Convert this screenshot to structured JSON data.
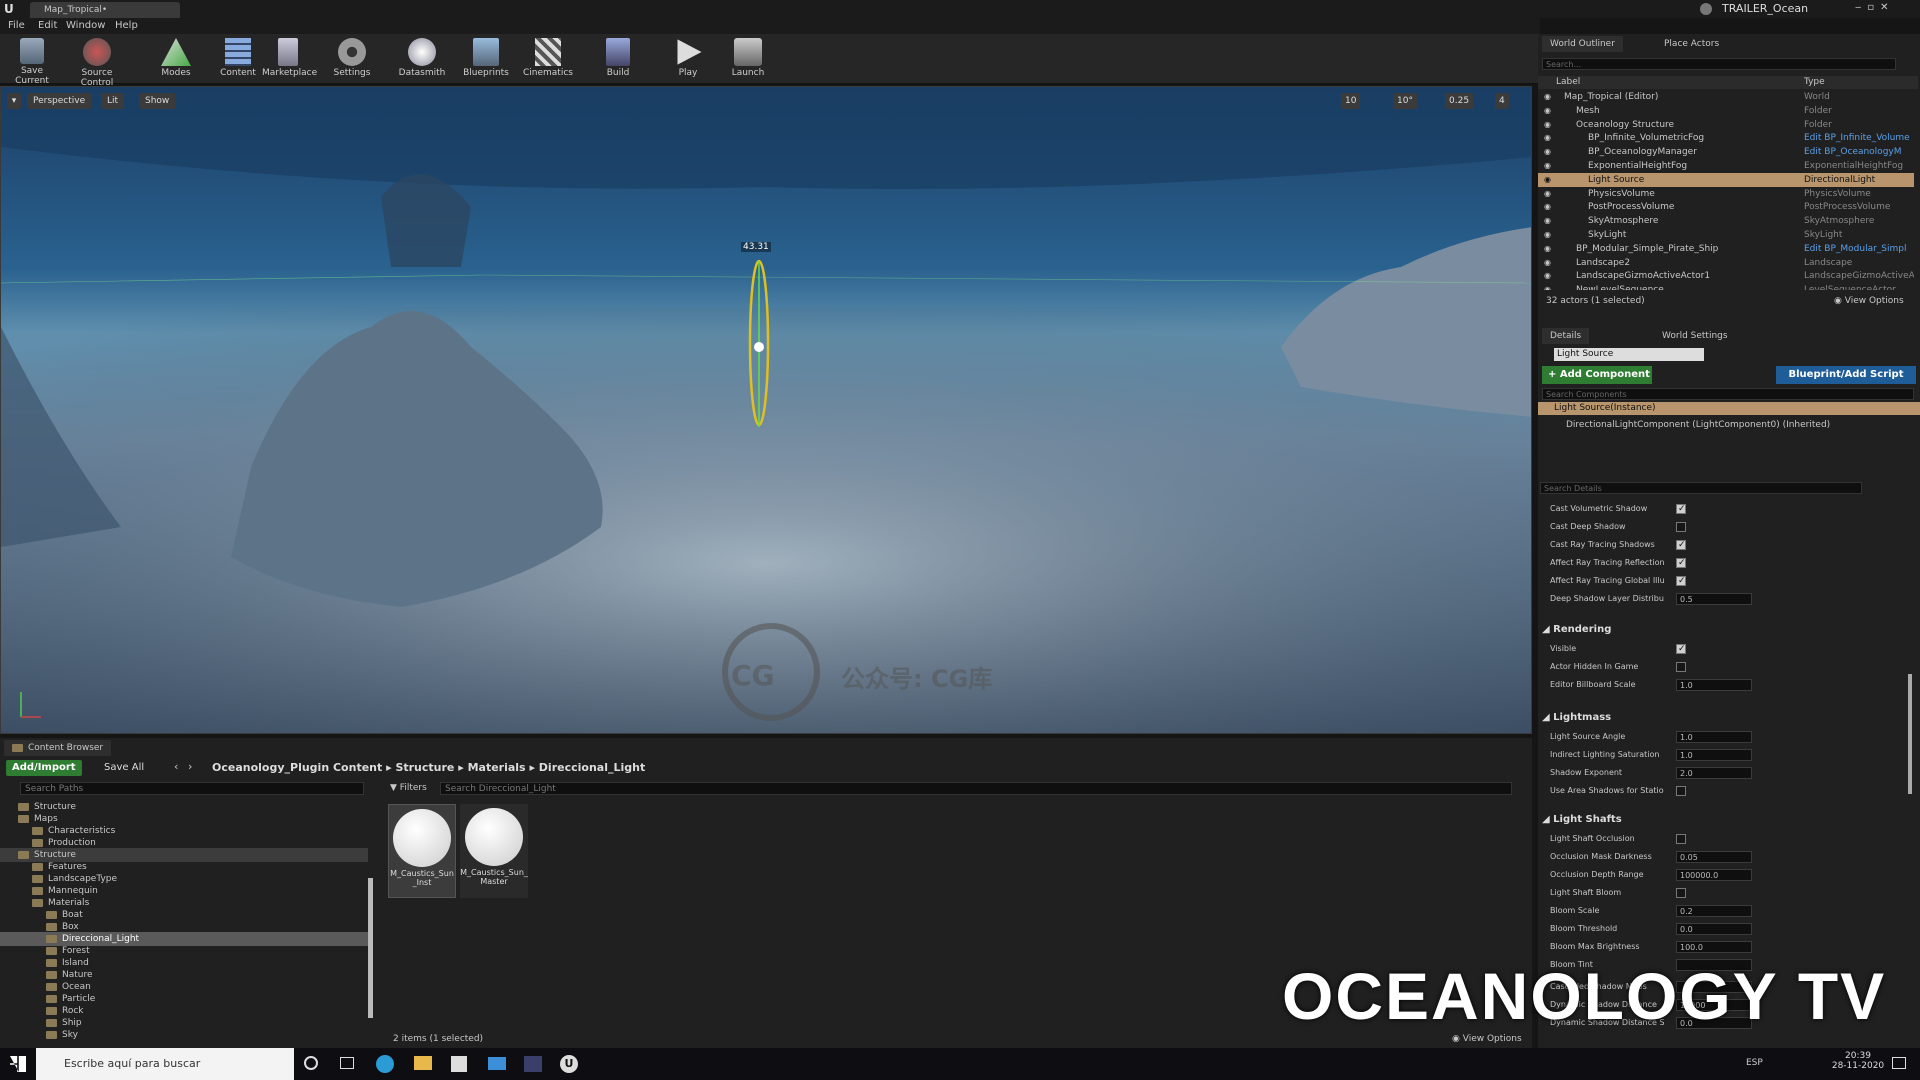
{
  "window": {
    "tab": "Map_Tropical•",
    "project": "TRAILER_Ocean"
  },
  "menu": [
    "File",
    "Edit",
    "Window",
    "Help"
  ],
  "toolbar": [
    "Save Current",
    "Source Control",
    "Modes",
    "Content",
    "Marketplace",
    "Settings",
    "Datasmith",
    "Blueprints",
    "Cinematics",
    "Build",
    "Play",
    "Launch"
  ],
  "viewport": {
    "perspective": "Perspective",
    "lit": "Lit",
    "show": "Show",
    "grid_snap": "10",
    "rot_snap": "10°",
    "scale_snap": "0.25",
    "cam_speed": "4",
    "gizmo_value": "43.31",
    "watermark_text": "公众号: CG库",
    "watermark_logo": "CG"
  },
  "content_browser": {
    "tab": "Content Browser",
    "add_import": "Add/Import",
    "save_all": "Save All",
    "path": [
      "Oceanology_Plugin Content",
      "Structure",
      "Materials",
      "Direccional_Light"
    ],
    "search_paths": "Search Paths",
    "filters": "Filters",
    "search_assets": "Search Direccional_Light",
    "tree": [
      "Structure",
      "Maps",
      "Characteristics",
      "Production",
      "Structure",
      "Features",
      "LandscapeType",
      "Mannequin",
      "Materials",
      "Boat",
      "Box",
      "Direccional_Light",
      "Forest",
      "Island",
      "Nature",
      "Ocean",
      "Particle",
      "Rock",
      "Ship",
      "Sky"
    ],
    "assets": [
      {
        "name": "M_Caustics_Sun_Inst"
      },
      {
        "name": "M_Caustics_Sun_Master"
      }
    ],
    "status": "2 items (1 selected)",
    "view_options": "View Options"
  },
  "outliner": {
    "tabs": [
      "World Outliner",
      "Place Actors"
    ],
    "search": "Search...",
    "col_label": "Label",
    "col_type": "Type",
    "rows": [
      {
        "label": "Map_Tropical (Editor)",
        "type": "World"
      },
      {
        "label": "Mesh",
        "type": "Folder"
      },
      {
        "label": "Oceanology Structure",
        "type": "Folder"
      },
      {
        "label": "BP_Infinite_VolumetricFog",
        "type": "Edit BP_Infinite_Volume"
      },
      {
        "label": "BP_OceanologyManager",
        "type": "Edit BP_OceanologyM"
      },
      {
        "label": "ExponentialHeightFog",
        "type": "ExponentialHeightFog"
      },
      {
        "label": "Light Source",
        "type": "DirectionalLight"
      },
      {
        "label": "PhysicsVolume",
        "type": "PhysicsVolume"
      },
      {
        "label": "PostProcessVolume",
        "type": "PostProcessVolume"
      },
      {
        "label": "SkyAtmosphere",
        "type": "SkyAtmosphere"
      },
      {
        "label": "SkyLight",
        "type": "SkyLight"
      },
      {
        "label": "BP_Modular_Simple_Pirate_Ship",
        "type": "Edit BP_Modular_Simpl"
      },
      {
        "label": "Landscape2",
        "type": "Landscape"
      },
      {
        "label": "LandscapeGizmoActiveActor1",
        "type": "LandscapeGizmoActiveA"
      },
      {
        "label": "NewLevelSequence",
        "type": "LevelSequenceActor"
      }
    ],
    "count": "32 actors (1 selected)",
    "view_options": "View Options"
  },
  "details": {
    "tabs": [
      "Details",
      "World Settings"
    ],
    "name": "Light Source",
    "add_component": "Add Component",
    "blueprint": "Blueprint/Add Script",
    "search_components": "Search Components",
    "instance": "Light Source(Instance)",
    "component": "DirectionalLightComponent (LightComponent0) (Inherited)",
    "search_details": "Search Details",
    "props1": [
      {
        "label": "Cast Volumetric Shadow",
        "checked": true
      },
      {
        "label": "Cast Deep Shadow",
        "checked": false
      },
      {
        "label": "Cast Ray Tracing Shadows",
        "checked": true
      },
      {
        "label": "Affect Ray Tracing Reflections",
        "checked": true
      },
      {
        "label": "Affect Ray Tracing Global Illum",
        "checked": true
      },
      {
        "label": "Deep Shadow Layer Distribution",
        "value": "0.5"
      }
    ],
    "rendering": "Rendering",
    "props2": [
      {
        "label": "Visible",
        "checked": true
      },
      {
        "label": "Actor Hidden In Game",
        "checked": false
      },
      {
        "label": "Editor Billboard Scale",
        "value": "1.0"
      }
    ],
    "lightmass": "Lightmass",
    "props3": [
      {
        "label": "Light Source Angle",
        "value": "1.0"
      },
      {
        "label": "Indirect Lighting Saturation",
        "value": "1.0"
      },
      {
        "label": "Shadow Exponent",
        "value": "2.0"
      },
      {
        "label": "Use Area Shadows for Stationa",
        "checked": false
      }
    ],
    "lightshafts": "Light Shafts",
    "props4": [
      {
        "label": "Light Shaft Occlusion",
        "checked": false
      },
      {
        "label": "Occlusion Mask Darkness",
        "value": "0.05"
      },
      {
        "label": "Occlusion Depth Range",
        "value": "100000.0"
      },
      {
        "label": "Light Shaft Bloom",
        "checked": false
      },
      {
        "label": "Bloom Scale",
        "value": "0.2"
      },
      {
        "label": "Bloom Threshold",
        "value": "0.0"
      },
      {
        "label": "Bloom Max Brightness",
        "value": "100.0"
      },
      {
        "label": "Bloom Tint",
        "value": ""
      }
    ],
    "props5": [
      {
        "label": "Cascaded Shadow Maps",
        "value": ""
      },
      {
        "label": "Dynamic Shadow Distance",
        "value": "10000"
      },
      {
        "label": "Dynamic Shadow Distance Sta",
        "value": "0.0"
      }
    ]
  },
  "overlay": "OCEANOLOGY TV",
  "taskbar": {
    "search": "Escribe aquí para buscar",
    "lang": "ESP",
    "time": "20:39",
    "date": "28-11-2020"
  }
}
